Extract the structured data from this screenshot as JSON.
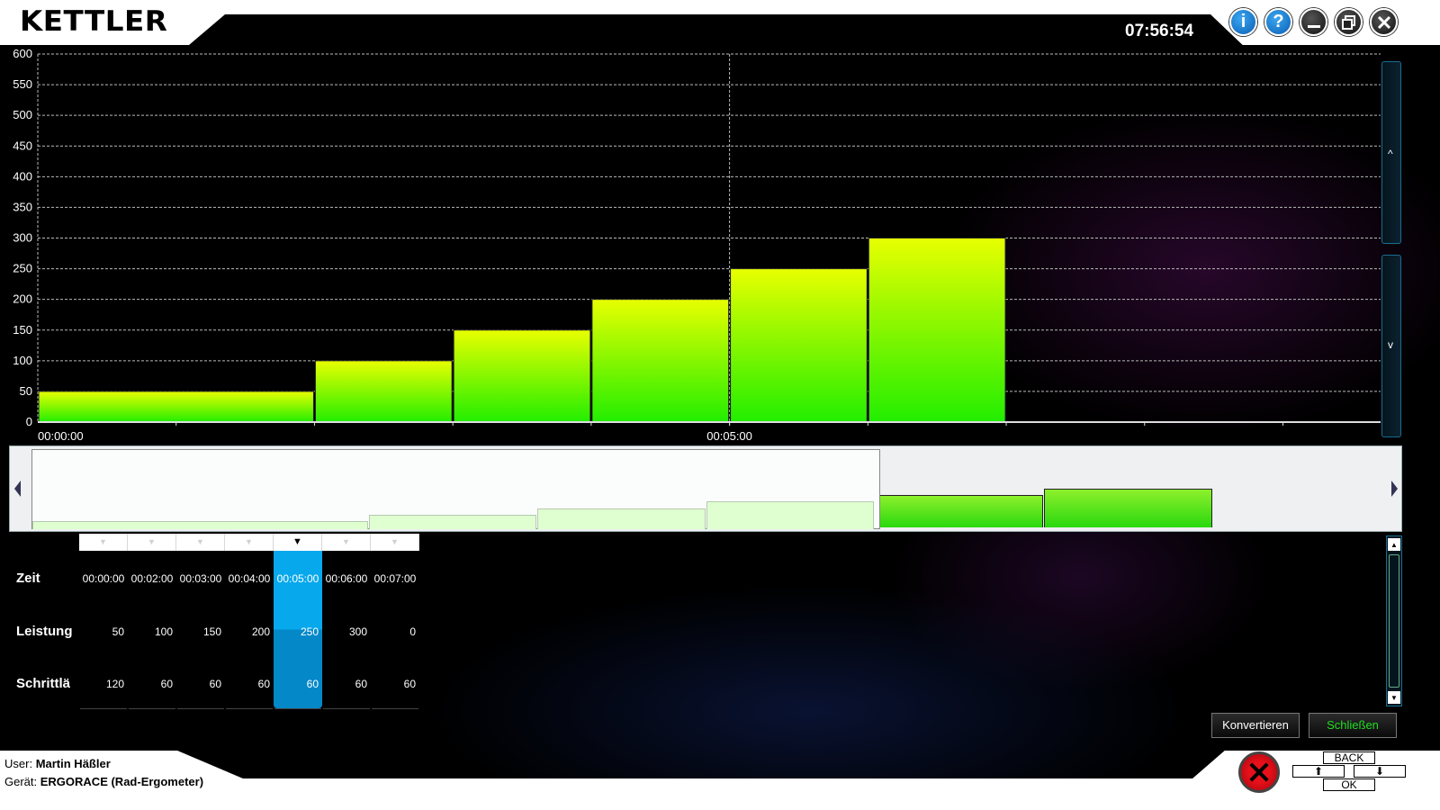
{
  "header": {
    "logo": "KETTLER",
    "clock": "07:56:54",
    "buttons": {
      "info": "i",
      "help": "?"
    }
  },
  "chart_data": {
    "type": "bar",
    "yticks": [
      "600",
      "550",
      "500",
      "450",
      "400",
      "350",
      "300",
      "250",
      "200",
      "150",
      "100",
      "50",
      "0"
    ],
    "ylim": [
      0,
      600
    ],
    "xtick_labels": [
      "00:00:00",
      "00:05:00"
    ],
    "bars": [
      {
        "start_s": 0,
        "end_s": 120,
        "value": 50
      },
      {
        "start_s": 120,
        "end_s": 180,
        "value": 100
      },
      {
        "start_s": 180,
        "end_s": 240,
        "value": 150
      },
      {
        "start_s": 240,
        "end_s": 300,
        "value": 200
      },
      {
        "start_s": 300,
        "end_s": 360,
        "value": 250
      },
      {
        "start_s": 360,
        "end_s": 420,
        "value": 300
      }
    ],
    "grid": true
  },
  "side_scroll": {
    "up": "^",
    "down": "v"
  },
  "table": {
    "row_labels": {
      "time": "Zeit",
      "power": "Leistung",
      "cadence": "Schrittlä"
    },
    "selected_index": 4,
    "columns": [
      {
        "time": "00:00:00",
        "power": "50",
        "cadence": "120"
      },
      {
        "time": "00:02:00",
        "power": "100",
        "cadence": "60"
      },
      {
        "time": "00:03:00",
        "power": "150",
        "cadence": "60"
      },
      {
        "time": "00:04:00",
        "power": "200",
        "cadence": "60"
      },
      {
        "time": "00:05:00",
        "power": "250",
        "cadence": "60"
      },
      {
        "time": "00:06:00",
        "power": "300",
        "cadence": "60"
      },
      {
        "time": "00:07:00",
        "power": "0",
        "cadence": "60"
      }
    ]
  },
  "actions": {
    "convert": "Konvertieren",
    "close": "Schließen"
  },
  "footer": {
    "user_label": "User:",
    "user_name": "Martin Häßler",
    "device_label": "Gerät:",
    "device_name": "ERGORACE (Rad-Ergometer)",
    "keys": {
      "back": "BACK",
      "ok": "OK",
      "up": "⬆",
      "down": "⬇"
    }
  },
  "colors": {
    "accent": "#08a8ec",
    "bar_top": "#f0ff00",
    "bar_bottom": "#22ee00",
    "close_text": "#22dd22"
  }
}
